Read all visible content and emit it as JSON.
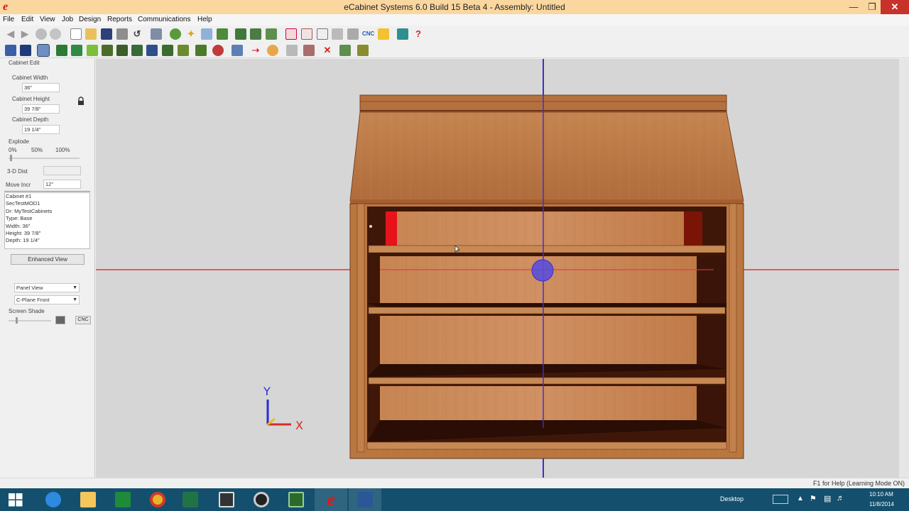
{
  "window": {
    "title": "eCabinet Systems 6.0 Build 15 Beta 4 - Assembly: Untitled",
    "app_icon": "e"
  },
  "menu": [
    "File",
    "Edit",
    "View",
    "Job",
    "Design",
    "Reports",
    "Communications",
    "Help"
  ],
  "panel": {
    "section_title": "Cabinet Edit",
    "width_label": "Cabinet Width",
    "width_value": "36\"",
    "height_label": "Cabinet Height",
    "height_value": "39 7/8\"",
    "depth_label": "Cabinet Depth",
    "depth_value": "19 1/4\"",
    "explode_label": "Explode",
    "explode_ticks": [
      "0%",
      "50%",
      "100%"
    ],
    "explode_value": 0,
    "dist_label": "3-D Dist",
    "dist_value": "",
    "move_label": "Move Incr",
    "move_value": "12\"",
    "info": {
      "line1": "Cabinet #1",
      "line2": "SecTestMOD1",
      "line3": "Dr: MyTestCabinets",
      "line4": "Type: Base",
      "line5": "Width: 36\"",
      "line6": "Height: 39 7/8\"",
      "line7": "Depth: 19 1/4\""
    },
    "enhanced_view_label": "Enhanced View",
    "view_select": "Panel View",
    "plane_select": "C-Plane Front",
    "screen_shade_label": "Screen Shade",
    "screen_shade_value": 0.1,
    "cnc_label": "CNC"
  },
  "viewport": {
    "axis_y_label": "Y",
    "axis_x_label": "X",
    "colors": {
      "background": "#d6d6d6",
      "wood_light": "#c98a58",
      "wood_mid": "#b87444",
      "wood_dark": "#4a1c0e",
      "crosshair_red": "#e0393a",
      "crosshair_blue": "#3b2fd0",
      "selection_red": "#e8121a"
    }
  },
  "status": {
    "text": "F1 for Help (Learning Mode ON)"
  },
  "taskbar": {
    "desktop_label": "Desktop",
    "time": "10:10 AM",
    "date": "11/8/2014",
    "apps": [
      "windows-start",
      "internet-explorer",
      "file-explorer",
      "excel-green",
      "chrome",
      "excel",
      "app-square",
      "app-disc",
      "app-display",
      "ecabinet",
      "word"
    ]
  }
}
